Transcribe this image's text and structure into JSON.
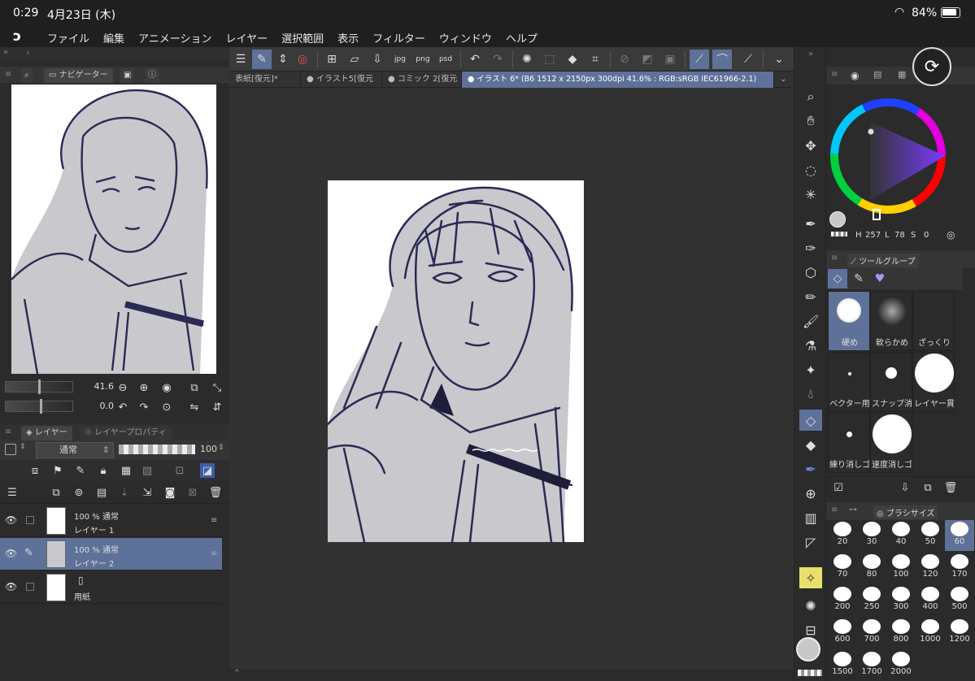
{
  "status": {
    "time": "0:29",
    "date": "4月23日 (木)",
    "battery": "84%"
  },
  "menu": [
    "ファイル",
    "編集",
    "アニメーション",
    "レイヤー",
    "選択範囲",
    "表示",
    "フィルター",
    "ウィンドウ",
    "ヘルプ"
  ],
  "tabs": [
    {
      "label": "表紙[復元]*"
    },
    {
      "label": "● イラスト5[復元"
    },
    {
      "label": "● コミック 2[復元"
    },
    {
      "label": "● イラスト 6* (B6 1512 x 2150px 300dpi 41.6% : RGB:sRGB IEC61966-2.1)"
    }
  ],
  "navigator": {
    "tab_label": "ナビゲーター",
    "zoom": "41.6",
    "rotation": "0.0"
  },
  "layers_panel": {
    "tab_layer": "レイヤー",
    "tab_props": "レイヤープロパティ",
    "blend_mode": "通常",
    "opacity": "100",
    "layers": [
      {
        "line1": "100 % 通常",
        "line2": "レイヤー 1",
        "selected": false
      },
      {
        "line1": "100 % 通常",
        "line2": "レイヤー 2",
        "selected": true
      },
      {
        "line1": "",
        "line2": "用紙",
        "selected": false
      }
    ]
  },
  "color": {
    "h": "257",
    "l": "78",
    "s": "0"
  },
  "tool_group": {
    "title": "ツールグループ",
    "brushes": [
      {
        "label": "硬め",
        "selected": true
      },
      {
        "label": "軟らかめ",
        "selected": false
      },
      {
        "label": "ざっくり",
        "selected": false
      },
      {
        "label": "ベクター用",
        "selected": false
      },
      {
        "label": "スナップ消",
        "selected": false
      },
      {
        "label": "レイヤー貫",
        "selected": false
      },
      {
        "label": "練り消しゴ",
        "selected": false
      },
      {
        "label": "速度消しゴ",
        "selected": false
      }
    ]
  },
  "brush_size": {
    "title": "ブラシサイズ",
    "sizes": [
      "20",
      "30",
      "40",
      "50",
      "60",
      "70",
      "80",
      "100",
      "120",
      "170",
      "200",
      "250",
      "300",
      "400",
      "500",
      "600",
      "700",
      "800",
      "1000",
      "1200",
      "1500",
      "1700",
      "2000"
    ],
    "selected": "60"
  },
  "colors": {
    "accent": "#5e7199",
    "sketch": "#2a2a55",
    "skin": "#c9c9cd"
  }
}
